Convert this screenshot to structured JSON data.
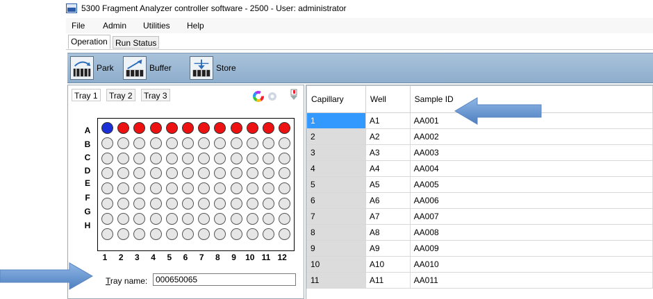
{
  "window": {
    "title": "5300 Fragment Analyzer controller software - 2500 - User: administrator"
  },
  "menu": [
    "File",
    "Admin",
    "Utilities",
    "Help"
  ],
  "tabs": [
    {
      "label": "Operation"
    },
    {
      "label": "Run Status"
    }
  ],
  "toolbar": [
    {
      "label": "Park"
    },
    {
      "label": "Buffer"
    },
    {
      "label": "Store"
    }
  ],
  "tray_panel": {
    "tabs": [
      "Tray 1",
      "Tray 2",
      "Tray 3"
    ],
    "row_labels": [
      "A",
      "B",
      "C",
      "D",
      "E",
      "F",
      "G",
      "H"
    ],
    "col_labels": [
      "1",
      "2",
      "3",
      "4",
      "5",
      "6",
      "7",
      "8",
      "9",
      "10",
      "11",
      "12"
    ],
    "well_colors": {
      "selected": "#1a2fd6",
      "assigned": "#ee1111",
      "empty": "#e6e6e6"
    },
    "tray_name_label": "Tray name:",
    "tray_name_value": "000650065"
  },
  "table": {
    "columns": [
      "Capillary",
      "Well",
      "Sample ID"
    ],
    "rows": [
      [
        "1",
        "A1",
        "AA001"
      ],
      [
        "2",
        "A2",
        "AA002"
      ],
      [
        "3",
        "A3",
        "AA003"
      ],
      [
        "4",
        "A4",
        "AA004"
      ],
      [
        "5",
        "A5",
        "AA005"
      ],
      [
        "6",
        "A6",
        "AA006"
      ],
      [
        "7",
        "A7",
        "AA007"
      ],
      [
        "8",
        "A8",
        "AA008"
      ],
      [
        "9",
        "A9",
        "AA009"
      ],
      [
        "10",
        "A10",
        "AA010"
      ],
      [
        "11",
        "A11",
        "AA011"
      ]
    ],
    "selected_row": 0
  },
  "colors": {
    "selection": "#3399ff",
    "toolbar": "#9db8d3",
    "arrow": "#6f9fd6"
  }
}
